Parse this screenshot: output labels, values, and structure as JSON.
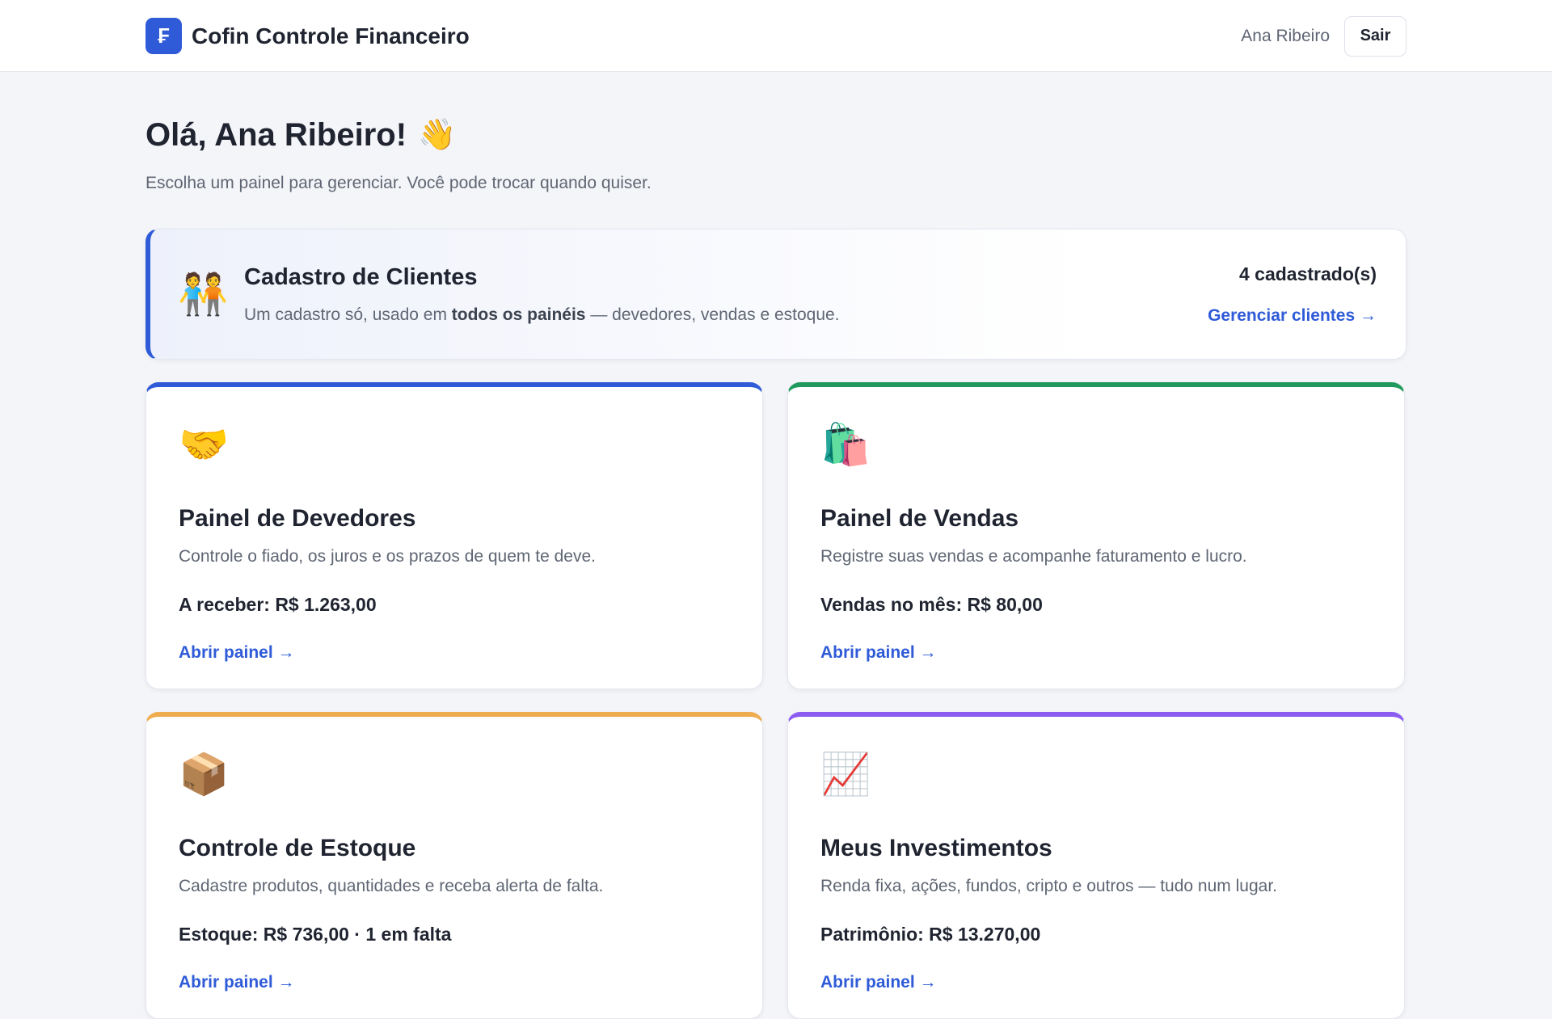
{
  "header": {
    "logo_glyph": "₣",
    "app_title": "Cofin Controle Financeiro",
    "user_name": "Ana Ribeiro",
    "logout_label": "Sair"
  },
  "welcome": {
    "greeting": "Olá, Ana Ribeiro!",
    "wave_emoji": "👋",
    "subtitle": "Escolha um painel para gerenciar. Você pode trocar quando quiser."
  },
  "clients_banner": {
    "icon": "🧑‍🤝‍🧑",
    "title": "Cadastro de Clientes",
    "desc_before": "Um cadastro só, usado em ",
    "desc_bold": "todos os painéis",
    "desc_after": " — devedores, vendas e estoque.",
    "count": "4 cadastrado(s)",
    "manage_link": "Gerenciar clientes →"
  },
  "panels": [
    {
      "icon": "🤝",
      "title": "Painel de Devedores",
      "description": "Controle o fiado, os juros e os prazos de quem te deve.",
      "stat": "A receber: R$ 1.263,00",
      "link": "Abrir painel →",
      "accent": "#2f5bd8"
    },
    {
      "icon": "🛍️",
      "title": "Painel de Vendas",
      "description": "Registre suas vendas e acompanhe faturamento e lucro.",
      "stat": "Vendas no mês: R$ 80,00",
      "link": "Abrir painel →",
      "accent": "#1f9a5c"
    },
    {
      "icon": "📦",
      "title": "Controle de Estoque",
      "description": "Cadastre produtos, quantidades e receba alerta de falta.",
      "stat": "Estoque: R$ 736,00 · 1 em falta",
      "link": "Abrir painel →",
      "accent": "#efac4e"
    },
    {
      "icon": "📈",
      "title": "Meus Investimentos",
      "description": "Renda fixa, ações, fundos, cripto e outros — tudo num lugar.",
      "stat": "Patrimônio: R$ 13.270,00",
      "link": "Abrir painel →",
      "accent": "#8a5cf0"
    }
  ]
}
